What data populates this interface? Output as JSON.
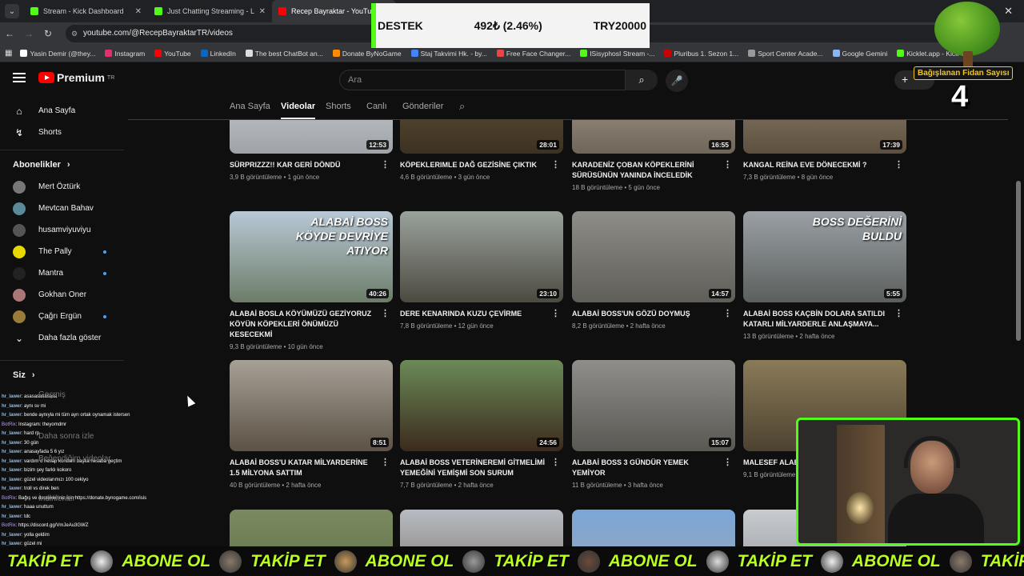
{
  "browser": {
    "tabs": [
      {
        "title": "Stream - Kick Dashboard",
        "color": "#53fc18"
      },
      {
        "title": "Just Chatting Streaming - Live S",
        "color": "#53fc18"
      },
      {
        "title": "Recep Bayraktar - YouTube",
        "color": "#ff0000"
      }
    ],
    "url": "youtube.com/@RecepBayraktarTR/videos",
    "bookmarks": [
      {
        "label": "Yasin Demir (@they...",
        "color": "#ffffff"
      },
      {
        "label": "Instagram",
        "color": "#e1306c"
      },
      {
        "label": "YouTube",
        "color": "#ff0000"
      },
      {
        "label": "LinkedIn",
        "color": "#0a66c2"
      },
      {
        "label": "The best ChatBot an...",
        "color": "#dddddd"
      },
      {
        "label": "Donate ByNoGame",
        "color": "#ff8c00"
      },
      {
        "label": "Staj Takvimi Hk. - by...",
        "color": "#4285f4"
      },
      {
        "label": "Free Face Changer...",
        "color": "#e44"
      },
      {
        "label": "ISisyphosI Stream -...",
        "color": "#53fc18"
      },
      {
        "label": "Pluribus 1. Sezon 1...",
        "color": "#c00"
      },
      {
        "label": "Sport Center Acade...",
        "color": "#999"
      },
      {
        "label": "Google Gemini",
        "color": "#8ab4f8"
      },
      {
        "label": "Kicklet.app - Kick C...",
        "color": "#53fc18"
      }
    ]
  },
  "youtube": {
    "logo": "Premium",
    "region": "TR",
    "search_placeholder": "Ara",
    "sidebar_main": [
      {
        "label": "Ana Sayfa"
      },
      {
        "label": "Shorts"
      }
    ],
    "subs_header": "Abonelikler",
    "subscriptions": [
      {
        "label": "Mert Öztürk",
        "color": "#777",
        "dot": false
      },
      {
        "label": "Mevtcan Bahav",
        "color": "#5a8a9a",
        "dot": false
      },
      {
        "label": "husamviyuviyu",
        "color": "#555",
        "dot": false
      },
      {
        "label": "The Pally",
        "color": "#e6d800",
        "dot": true
      },
      {
        "label": "Mantra",
        "color": "#222",
        "dot": true
      },
      {
        "label": "Gokhan Oner",
        "color": "#a77",
        "dot": false
      },
      {
        "label": "Çağrı Ergün",
        "color": "#9a7b3a",
        "dot": true
      }
    ],
    "show_more": "Daha fazla göster",
    "you_header": "Siz",
    "channel_tabs": [
      "Ana Sayfa",
      "Videolar",
      "Shorts",
      "Canlı",
      "Gönderiler"
    ],
    "active_tab": "Videolar",
    "videos": [
      {
        "title": "SÜRPRIZZZ!! KAR GERİ DÖNDÜ",
        "meta": "3,9 B görüntüleme • 1 gün önce",
        "duration": "12:53",
        "overlay": "",
        "bg": "linear-gradient(#d7d9dc,#9ea3a8)"
      },
      {
        "title": "KÖPEKLERIMLE DAĞ GEZİSİNE ÇIKTIK",
        "meta": "4,6 B görüntüleme • 3 gün önce",
        "duration": "28:01",
        "overlay": "",
        "bg": "linear-gradient(#6b5a3c,#3c3222)"
      },
      {
        "title": "KARADENİZ ÇOBAN KÖPEKLERİNİ SÜRÜSÜNÜN YANINDA İNCELEDİK",
        "meta": "18 B görüntüleme • 5 gün önce",
        "duration": "16:55",
        "overlay": "",
        "bg": "linear-gradient(#b5a99a,#6f6559)"
      },
      {
        "title": "KANGAL REİNA EVE DÖNECEKMİ ?",
        "meta": "7,3 B görüntüleme • 8 gün önce",
        "duration": "17:39",
        "overlay": "",
        "bg": "linear-gradient(#9a8b73,#5d5040)"
      },
      {
        "title": "ALABAİ BOSLA KÖYÜMÜZÜ GEZİYORUZ KÖYÜN KÖPEKLERİ ÖNÜMÜZÜ KESECEKMİ",
        "meta": "9,3 B görüntüleme • 10 gün önce",
        "duration": "40:26",
        "overlay": "ALABAİ BOSS KÖYDE DEVRİYE ATIYOR",
        "bg": "linear-gradient(#b8c8d6,#6c7c68)"
      },
      {
        "title": "DERE KENARINDA KUZU ÇEVİRME",
        "meta": "7,8 B görüntüleme • 12 gün önce",
        "duration": "23:10",
        "overlay": "",
        "bg": "linear-gradient(#9aa29c,#4c4a40)"
      },
      {
        "title": "ALABAİ BOSS'UN GÖZÜ DOYMUŞ",
        "meta": "8,2 B görüntüleme • 2 hafta önce",
        "duration": "14:57",
        "overlay": "",
        "bg": "linear-gradient(#8e8d88,#5f5e58)"
      },
      {
        "title": "ALABAİ BOSS KAÇBİN DOLARA SATILDI KATARLI MİLYARDERLE ANLAŞMAYA...",
        "meta": "13 B görüntüleme • 2 hafta önce",
        "duration": "5:55",
        "overlay": "BOSS DEĞERİNİ BULDU",
        "bg": "linear-gradient(#9aa0a6,#5b5f5c)"
      },
      {
        "title": "ALABAİ BOSS'U KATAR MİLYARDERİNE 1.5 MİLYONA SATTIM",
        "meta": "40 B görüntüleme • 2 hafta önce",
        "duration": "8:51",
        "overlay": "",
        "bg": "linear-gradient(#a6a096,#5c5246)"
      },
      {
        "title": "ALABAİ BOSS VETERİNEREMİ GİTMELİMİ YEMEĞİNİ YEMİŞMİ SON SURUM",
        "meta": "7,7 B görüntüleme • 2 hafta önce",
        "duration": "24:56",
        "overlay": "",
        "bg": "linear-gradient(#6b8a58,#3c2a1c)"
      },
      {
        "title": "ALABAİ BOSS 3 GÜNDÜR YEMEK YEMİYOR",
        "meta": "11 B görüntüleme • 3 hafta önce",
        "duration": "15:07",
        "overlay": "",
        "bg": "linear-gradient(#8f8e8a,#595853)"
      },
      {
        "title": "MALESEF ALAB...",
        "meta": "9,1 B görüntüleme • 3 hafta önce",
        "duration": "",
        "overlay": "",
        "bg": "linear-gradient(#8a7a58,#4c4230)"
      },
      {
        "title": "",
        "meta": "",
        "duration": "",
        "overlay": "",
        "bg": "linear-gradient(#7a8a60,#5c6a44)"
      },
      {
        "title": "",
        "meta": "",
        "duration": "",
        "overlay": "",
        "bg": "linear-gradient(#b6bcc4,#7a6a5a)"
      },
      {
        "title": "",
        "meta": "",
        "duration": "",
        "overlay": "",
        "bg": "linear-gradient(#7aa6d8,#a0a6aa)"
      },
      {
        "title": "",
        "meta": "",
        "duration": "",
        "overlay": "",
        "bg": "linear-gradient(#c8ccd0,#8a8c90)"
      }
    ]
  },
  "stream_overlay": {
    "donation": {
      "label": "DESTEK",
      "amount": "492₺ (2.46%)",
      "goal": "TRY20000"
    },
    "fidan_label": "Bağışlanan Fidan Sayısı",
    "fidan_count": "4",
    "ticker_items": [
      "TAKİP ET",
      "ABONE OL",
      "TAKİP ET",
      "ABONE OL",
      "TAKİP ET",
      "ABONE OL",
      "TAKİP ET",
      "ABONE OL",
      "TAKİP ET",
      "ABONE OL"
    ],
    "chat_ghost_labels": [
      "Geçmiş",
      "Daha sonra izle",
      "Beğendiğim videolar",
      "İndirilenler"
    ],
    "chat": [
      {
        "user": "hr_lawer",
        "text": "asasasasasasa",
        "bot": false
      },
      {
        "user": "hr_lawer",
        "text": "aynı sv mi",
        "bot": false
      },
      {
        "user": "hr_lawer",
        "text": "bende aynıyla mi tüm ayrı ortak oynamak istersen",
        "bot": false
      },
      {
        "user": "BotRix",
        "text": "Instagram: theyomdmr",
        "bot": true
      },
      {
        "user": "hr_lawer",
        "text": "hard rp",
        "bot": false
      },
      {
        "user": "hr_lawer",
        "text": "30 gün",
        "bot": false
      },
      {
        "user": "hr_lawer",
        "text": "anasayfada 5 6 yız",
        "bot": false
      },
      {
        "user": "hr_lawer",
        "text": "vardım o hesap kontlarlı başka hesaba geçtim",
        "bot": false
      },
      {
        "user": "hr_lawer",
        "text": "bizim şey farklı kokoro",
        "bot": false
      },
      {
        "user": "hr_lawer",
        "text": "güzel videolarımızı 100 cekiyo",
        "bot": false
      },
      {
        "user": "hr_lawer",
        "text": "troll vs direk ben",
        "bot": false
      },
      {
        "user": "BotRix",
        "text": "Bağış ve destekleriniz için https://donate.bynogame.com/isis",
        "bot": true
      },
      {
        "user": "hr_lawer",
        "text": "haaa unuttum",
        "bot": false
      },
      {
        "user": "hr_lawer",
        "text": "tdc",
        "bot": false
      },
      {
        "user": "BotRix",
        "text": "https://discord.gg/VmJeAu3GWZ",
        "bot": true
      },
      {
        "user": "hr_lawer",
        "text": "yolla geldim",
        "bot": false
      },
      {
        "user": "hr_lawer",
        "text": "güzel mi",
        "bot": false
      }
    ]
  }
}
